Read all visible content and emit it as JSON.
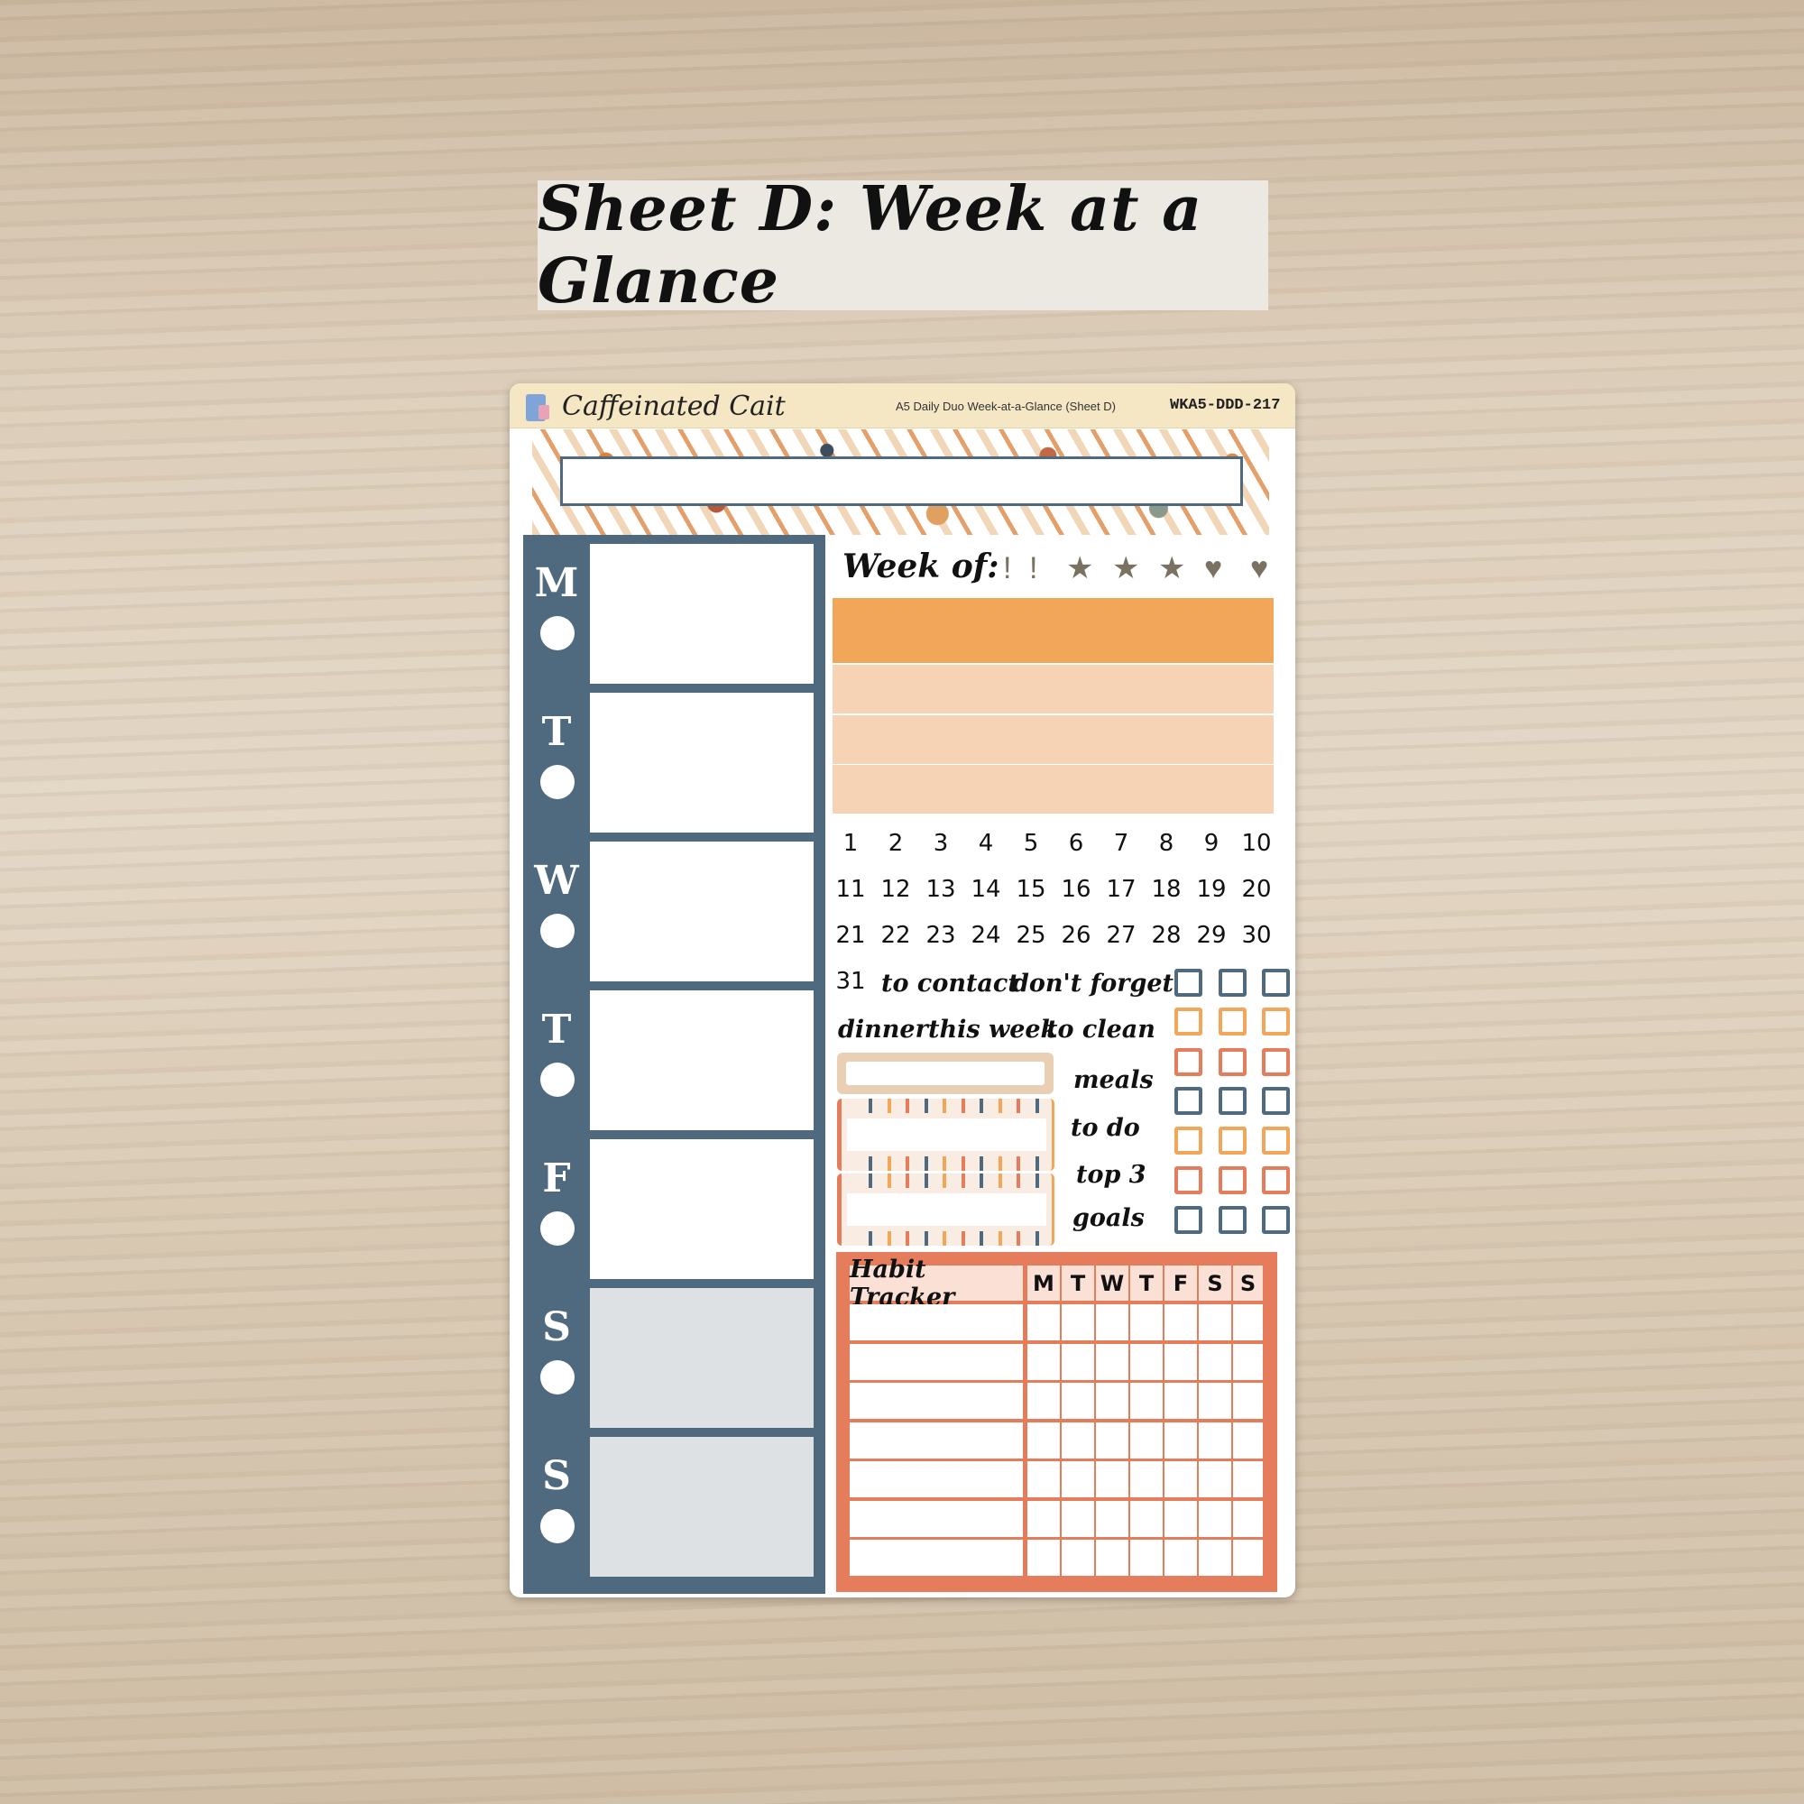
{
  "banner": {
    "title": "Sheet D: Week at a Glance"
  },
  "header": {
    "brand": "Caffeinated Cait",
    "product": "A5 Daily Duo Week-at-a-Glance (Sheet D)",
    "code": "WKA5-DDD-217"
  },
  "days": [
    "M",
    "T",
    "W",
    "T",
    "F",
    "S",
    "S"
  ],
  "week": {
    "label": "Week of:",
    "icons": [
      "exclamation-icon",
      "exclamation-icon",
      "star-icon",
      "star-icon",
      "star-icon",
      "heart-icon",
      "heart-icon"
    ]
  },
  "numbers": [
    "1",
    "2",
    "3",
    "4",
    "5",
    "6",
    "7",
    "8",
    "9",
    "10",
    "11",
    "12",
    "13",
    "14",
    "15",
    "16",
    "17",
    "18",
    "19",
    "20",
    "21",
    "22",
    "23",
    "24",
    "25",
    "26",
    "27",
    "28",
    "29",
    "30",
    "31"
  ],
  "labels": {
    "to_contact": "to contact",
    "dont_forget": "don't forget",
    "dinner": "dinner",
    "this_week": "this week",
    "to_clean": "to clean",
    "meals": "meals",
    "to_do": "to do",
    "top3": "top 3",
    "goals": "goals"
  },
  "habit": {
    "title": "Habit Tracker",
    "days": [
      "M",
      "T",
      "W",
      "T",
      "F",
      "S",
      "S"
    ]
  },
  "colors": {
    "blue": "#4f6a7f",
    "orange": "#f2a65a",
    "coral": "#e57c5c",
    "peach": "#f7d3b6",
    "gray": "#dde1e4",
    "header": "#f5e6c4"
  }
}
